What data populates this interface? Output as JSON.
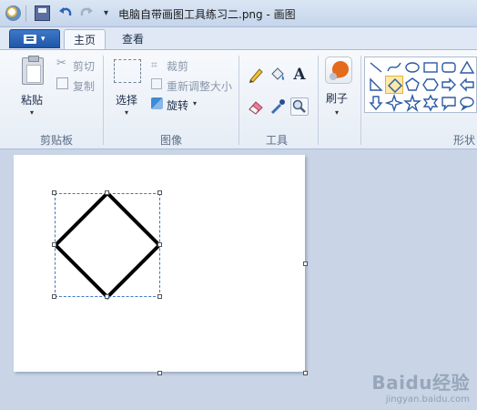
{
  "window": {
    "title": "电脑自带画图工具练习二.png - 画图"
  },
  "quick_access": {
    "customize_caret": "▾"
  },
  "tabs": {
    "file_caret": "▾",
    "home": "主页",
    "view": "查看"
  },
  "clipboard": {
    "paste": "粘贴",
    "cut": "剪切",
    "copy": "复制",
    "group_label": "剪贴板"
  },
  "image": {
    "select": "选择",
    "crop": "裁剪",
    "resize": "重新调整大小",
    "rotate": "旋转",
    "group_label": "图像"
  },
  "tools": {
    "text_glyph": "A",
    "group_label": "工具"
  },
  "brushes": {
    "label": "刷子"
  },
  "shapes": {
    "group_label": "形状",
    "items": [
      "line-icon",
      "curve-icon",
      "oval-icon",
      "rectangle-icon",
      "rounded-rect-icon",
      "triangle-icon",
      "right-triangle-icon",
      "diamond-icon",
      "pentagon-icon",
      "hexagon-icon",
      "right-arrow-icon",
      "left-arrow-icon",
      "down-arrow-icon",
      "four-point-star-icon",
      "five-point-star-icon",
      "six-point-star-icon",
      "callout-icon",
      "oval-callout-icon"
    ],
    "selected": "diamond-icon"
  },
  "watermark": {
    "logo": "Baidu经验",
    "url": "jingyan.baidu.com"
  },
  "colors": {
    "accent": "#1f56a8",
    "selection": "#3c78c4",
    "shape_selected_bg": "#fde9a8"
  }
}
